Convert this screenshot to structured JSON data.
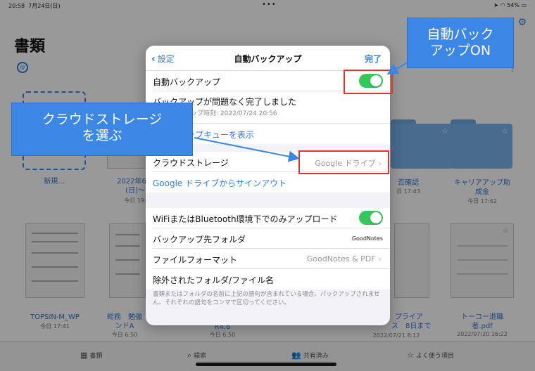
{
  "status_bar": {
    "time": "20:58",
    "date": "7月24日(日)",
    "battery": "54%"
  },
  "background": {
    "title": "書類",
    "new_label": "新規...",
    "tiles": [
      {
        "name": "2022年6月\n(日)～",
        "date": "今日 19:"
      },
      {
        "name": "否確認",
        "date": "日 17:43"
      },
      {
        "name": "キャリアアップ助\n成金",
        "date": "今日 17:42"
      },
      {
        "name": "TOPSIN-M_WP",
        "date": "今日 17:41"
      },
      {
        "name": "総務　勉強\nンドA",
        "date": "今日 6:50"
      },
      {
        "name": "R4.6",
        "date": "今日 6:50"
      },
      {
        "name": "プライア\nス　8日まで",
        "date": "2022/07/21 8:12"
      },
      {
        "name": "トーコー退職\n者.pdf",
        "date": "2022/07/20 16:22"
      }
    ],
    "tabbar": [
      "書類",
      "検索",
      "共有済み",
      "よく使う項目"
    ]
  },
  "modal": {
    "back_label": "設定",
    "title": "自動バックアップ",
    "done_label": "完了",
    "auto_backup_label": "自動バックアップ",
    "auto_backup_on": true,
    "status_main": "バックアップが問題なく完了しました",
    "status_sub": "最終バックアップ時刻: 2022/07/24 20:56",
    "queue_link": "バックアップキューを表示",
    "cloud_storage_label": "クラウドストレージ",
    "cloud_storage_value": "Google ドライブ",
    "signout_link": "Google ドライブからサインアウト",
    "wifi_only_label": "WiFiまたはBluetooth環境下でのみアップロード",
    "wifi_only_on": true,
    "dest_folder_label": "バックアップ先フォルダ",
    "dest_folder_value": "GoodNotes",
    "file_format_label": "ファイルフォーマット",
    "file_format_value": "GoodNotes & PDF",
    "excluded_label": "除外されたフォルダ/ファイル名",
    "footer_note": "書類またはフォルダの名前に上記の語句が含まれている場合、バックアップされません。それぞれの語句をコンマで区切ってください。"
  },
  "annotations": {
    "callout_right": "自動バック\nアップON",
    "callout_left": "クラウドストレージ\nを選ぶ",
    "highlight_color": "#e0352b",
    "callout_color": "#3c86e6"
  },
  "colors": {
    "accent": "#2f7be0",
    "toggle_on": "#34c759"
  }
}
